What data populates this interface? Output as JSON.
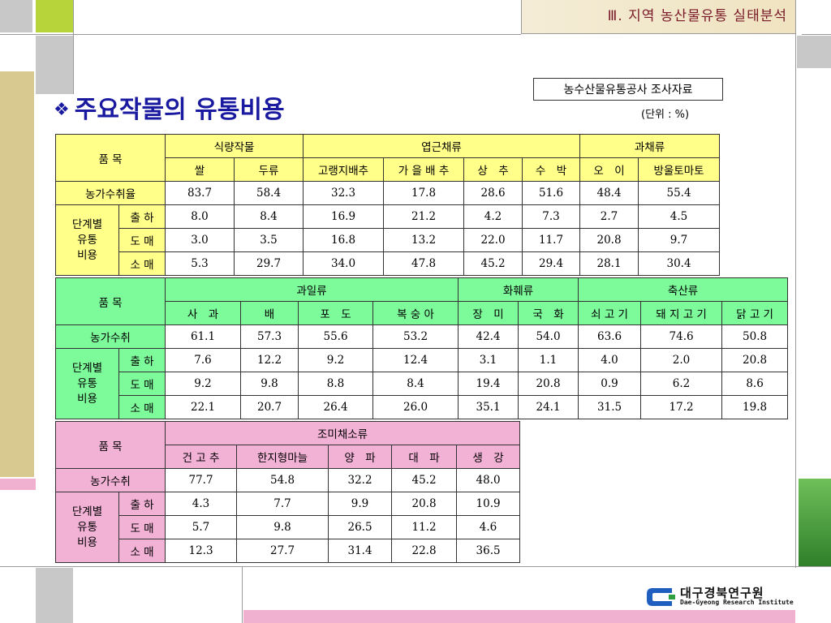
{
  "header": {
    "section": "Ⅲ. 지역 농산물유통 실태분석"
  },
  "title": {
    "bullet": "❖",
    "text": "주요작물의 유통비용"
  },
  "source": "농수산물유통공사 조사자료",
  "unit": "(단위 : %)",
  "labels": {
    "item": "품 목",
    "share": "농가수취율",
    "share2": "농가수취",
    "stage_l1": "단계별",
    "stage_l2": "유통",
    "stage_l3": "비용",
    "ship": "출 하",
    "wholesale": "도 매",
    "retail": "소 매"
  },
  "table1": {
    "groups": [
      "식량작물",
      "엽근채류",
      "과채류"
    ],
    "crops": [
      "쌀",
      "두류",
      "고랭지배추",
      "가 을 배 추",
      "상　추",
      "수　박",
      "오　이",
      "방울토마토"
    ],
    "share": [
      "83.7",
      "58.4",
      "32.3",
      "17.8",
      "28.6",
      "51.6",
      "48.4",
      "55.4"
    ],
    "ship": [
      "8.0",
      "8.4",
      "16.9",
      "21.2",
      "4.2",
      "7.3",
      "2.7",
      "4.5"
    ],
    "wholesale": [
      "3.0",
      "3.5",
      "16.8",
      "13.2",
      "22.0",
      "11.7",
      "20.8",
      "9.7"
    ],
    "retail": [
      "5.3",
      "29.7",
      "34.0",
      "47.8",
      "45.2",
      "29.4",
      "28.1",
      "30.4"
    ]
  },
  "table2": {
    "groups": [
      "과일류",
      "화훼류",
      "축산류"
    ],
    "crops": [
      "사　과",
      "배",
      "포　도",
      "복 숭 아",
      "장　미",
      "국　화",
      "쇠 고 기",
      "돼 지 고 기",
      "닭 고 기"
    ],
    "share": [
      "61.1",
      "57.3",
      "55.6",
      "53.2",
      "42.4",
      "54.0",
      "63.6",
      "74.6",
      "50.8"
    ],
    "ship": [
      "7.6",
      "12.2",
      "9.2",
      "12.4",
      "3.1",
      "1.1",
      "4.0",
      "2.0",
      "20.8"
    ],
    "wholesale": [
      "9.2",
      "9.8",
      "8.8",
      "8.4",
      "19.4",
      "20.8",
      "0.9",
      "6.2",
      "8.6"
    ],
    "retail": [
      "22.1",
      "20.7",
      "26.4",
      "26.0",
      "35.1",
      "24.1",
      "31.5",
      "17.2",
      "19.8"
    ]
  },
  "table3": {
    "groups": [
      "조미채소류"
    ],
    "crops": [
      "건 고 추",
      "한지형마늘",
      "양　파",
      "대　파",
      "생　강"
    ],
    "share": [
      "77.7",
      "54.8",
      "32.2",
      "45.2",
      "48.0"
    ],
    "ship": [
      "4.3",
      "7.7",
      "9.9",
      "20.8",
      "10.9"
    ],
    "wholesale": [
      "5.7",
      "9.8",
      "26.5",
      "11.2",
      "4.6"
    ],
    "retail": [
      "12.3",
      "27.7",
      "31.4",
      "22.8",
      "36.5"
    ]
  },
  "logo": {
    "name_ko": "대구경북연구원",
    "name_en": "Dae-Gyeong Research Institute"
  },
  "colors": {
    "title": "#1a1aa0",
    "table1_header": "#ffff8a",
    "table2_header": "#7dfa9a",
    "table3_header": "#f2b2d6",
    "logo_blue": "#1f5fbf",
    "logo_green": "#2f9f3f"
  }
}
